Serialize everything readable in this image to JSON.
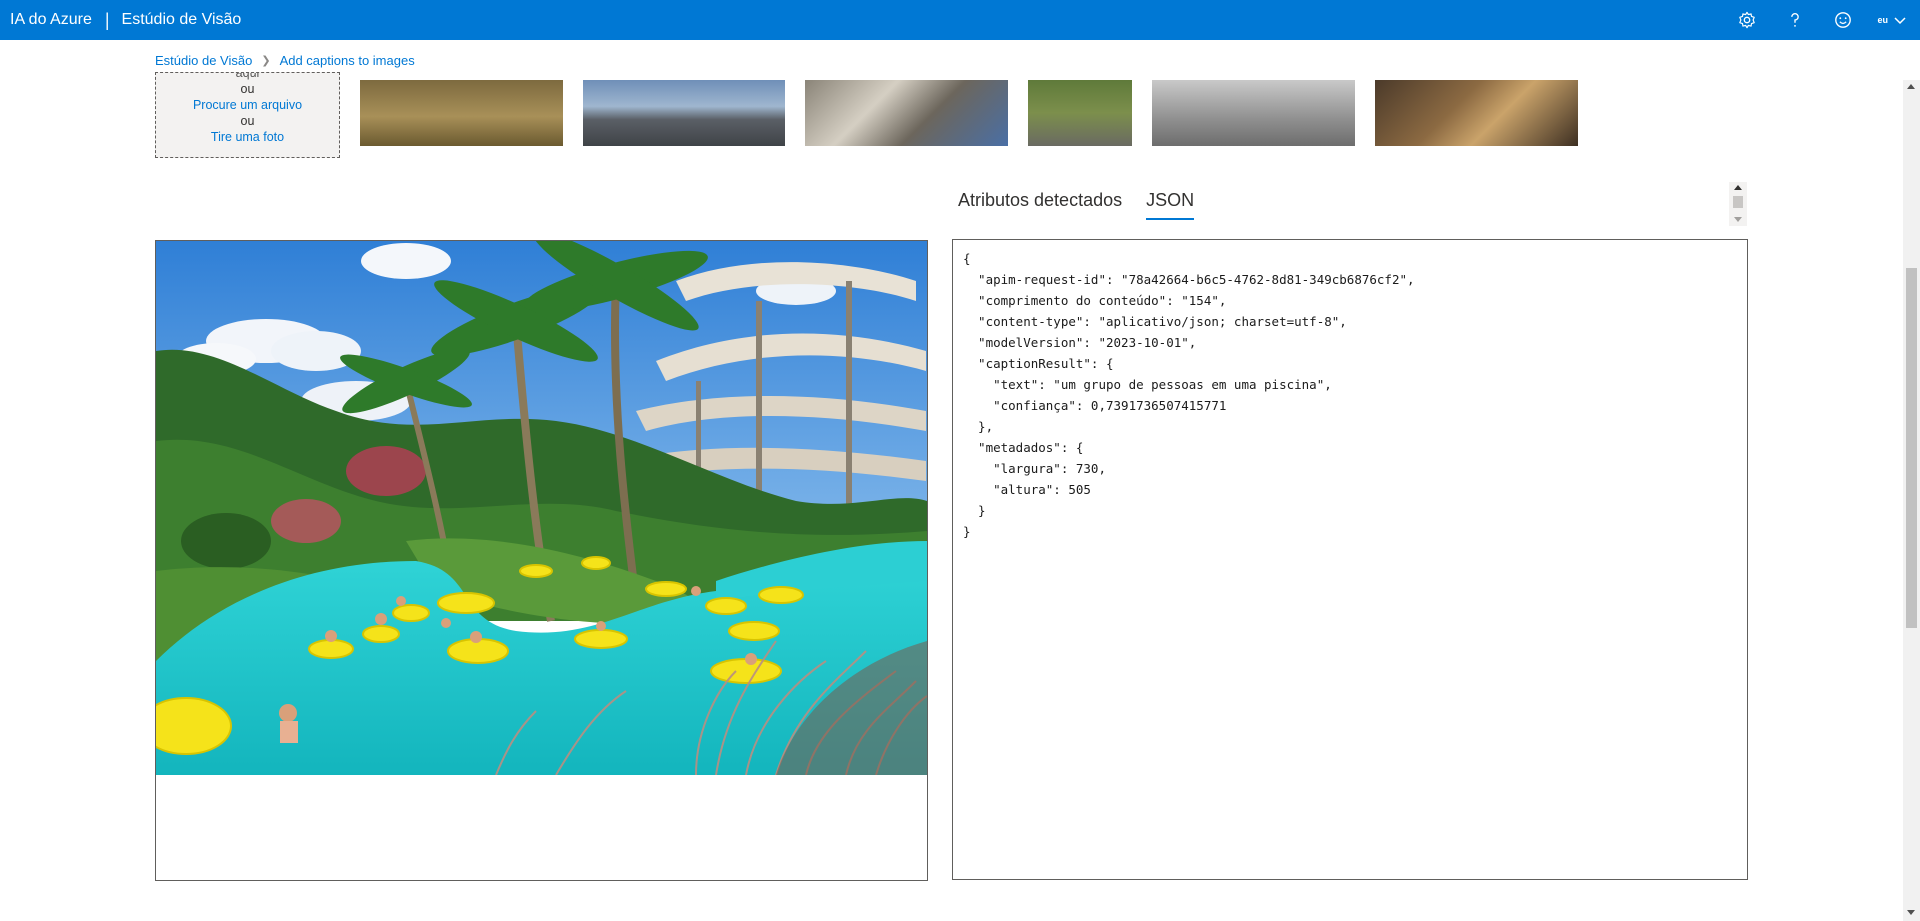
{
  "header": {
    "brand": "IA do Azure",
    "separator": "|",
    "product": "Estúdio de Visão",
    "icons": [
      "settings-icon",
      "help-icon",
      "feedback-smiley-icon"
    ],
    "user_initials": "eu"
  },
  "breadcrumb": {
    "root": "Estúdio de Visão",
    "current": "Add captions to images"
  },
  "upload": {
    "drop_text_partial": "aqui",
    "or1": "ou",
    "browse": "Procure um arquivo",
    "or2": "ou",
    "camera": "Tire uma foto"
  },
  "samples": [
    "sample-horse",
    "sample-rock-coast",
    "sample-building",
    "sample-baseball",
    "sample-skateboard",
    "sample-food"
  ],
  "tabs": [
    {
      "label": "Atributos detectados",
      "active": false
    },
    {
      "label": "JSON",
      "active": true
    }
  ],
  "json_lines": [
    "{",
    "  \"apim-request-id\": \"78a42664-b6c5-4762-8d81-349cb6876cf2\",",
    "  \"comprimento do conteúdo\": \"154\",",
    "  \"content-type\": \"aplicativo/json; charset=utf-8\",",
    "  \"modelVersion\": \"2023-10-01\",",
    "  \"captionResult\": {",
    "    \"text\": \"um grupo de pessoas em uma piscina\",",
    "    \"confiança\": 0,7391736507415771",
    "  },",
    "  \"metadados\": {",
    "    \"largura\": 730,",
    "    \"altura\": 505",
    "  }",
    "}"
  ],
  "colors": {
    "accent": "#0078d4",
    "pool": "#1fc7c9",
    "tube": "#f2e200"
  }
}
